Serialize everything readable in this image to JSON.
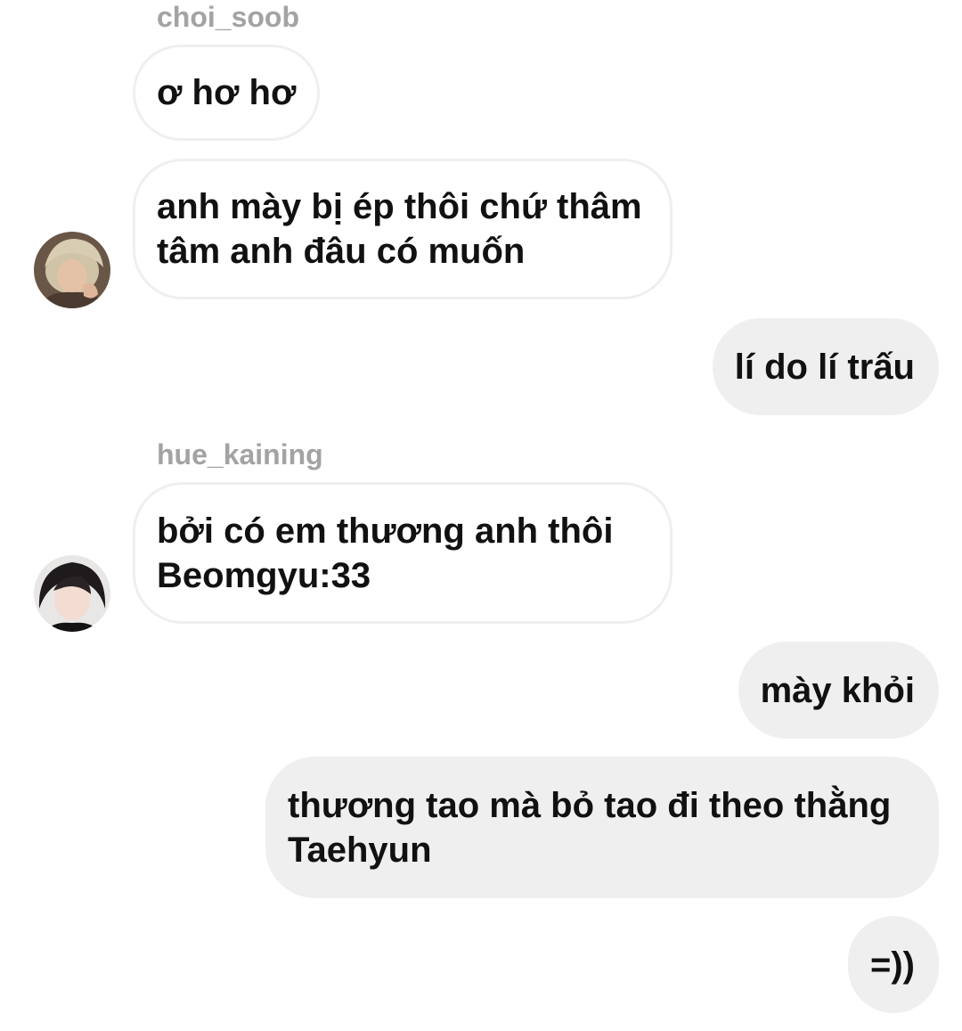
{
  "conversation": {
    "messages": [
      {
        "sender": "choi_soob",
        "direction": "incoming",
        "text": "ơ hơ hơ"
      },
      {
        "direction": "incoming",
        "text": "anh mày bị ép thôi chứ thâm tâm anh đâu có muốn",
        "avatar": "avatar-choi-soob"
      },
      {
        "direction": "outgoing",
        "text": "lí do lí trấu"
      },
      {
        "sender": "hue_kaining",
        "direction": "incoming",
        "text": "bởi có em thương anh thôi Beomgyu:33",
        "avatar": "avatar-hue-kaining"
      },
      {
        "direction": "outgoing",
        "text": "mày khỏi"
      },
      {
        "direction": "outgoing",
        "text": "thương tao mà bỏ tao đi theo thằng Taehyun"
      },
      {
        "direction": "outgoing",
        "text": "=))"
      }
    ]
  },
  "colors": {
    "incoming_border": "#efefef",
    "outgoing_background": "#efefef",
    "sender_name": "#a3a3a3",
    "message_text": "#111111"
  }
}
